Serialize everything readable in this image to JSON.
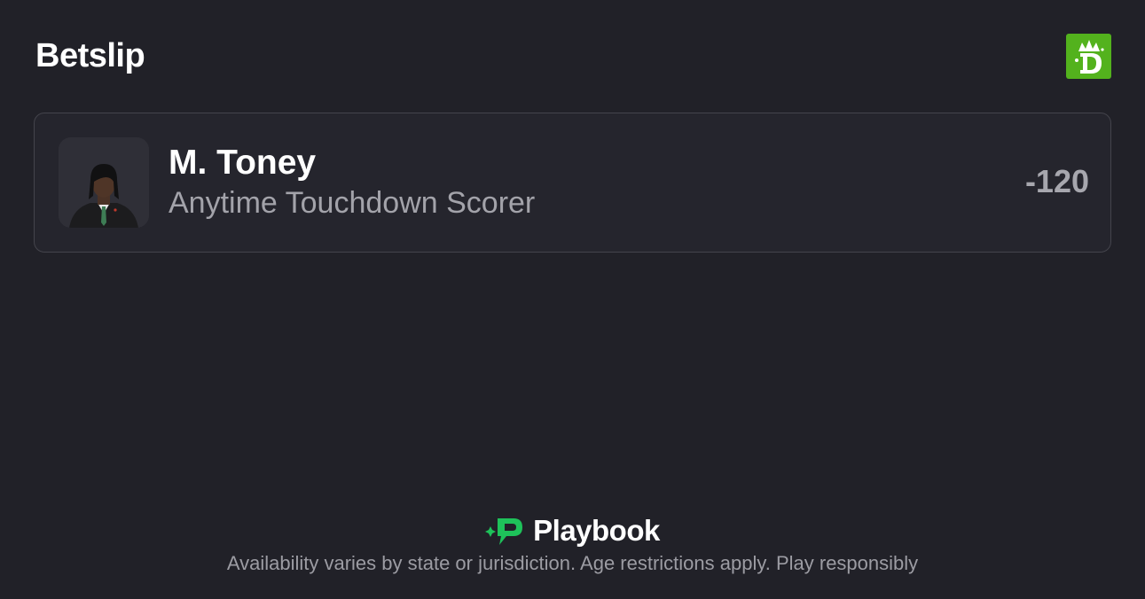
{
  "header": {
    "title": "Betslip",
    "brand_icon": "draftkings-crown-icon",
    "brand_color": "#53b21d"
  },
  "bet": {
    "player_photo_icon": "player-headshot",
    "player_name": "M. Toney",
    "market": "Anytime Touchdown Scorer",
    "odds": "-120"
  },
  "footer": {
    "logo_icon": "playbook-sparkle-p-icon",
    "logo_text": "Playbook",
    "logo_color": "#1ec25a",
    "disclaimer": "Availability varies by state or jurisdiction. Age restrictions apply. Play responsibly"
  },
  "colors": {
    "background": "#212128",
    "card": "#25252d",
    "card_border": "#44444c",
    "secondary_text": "#a3a3aa"
  }
}
